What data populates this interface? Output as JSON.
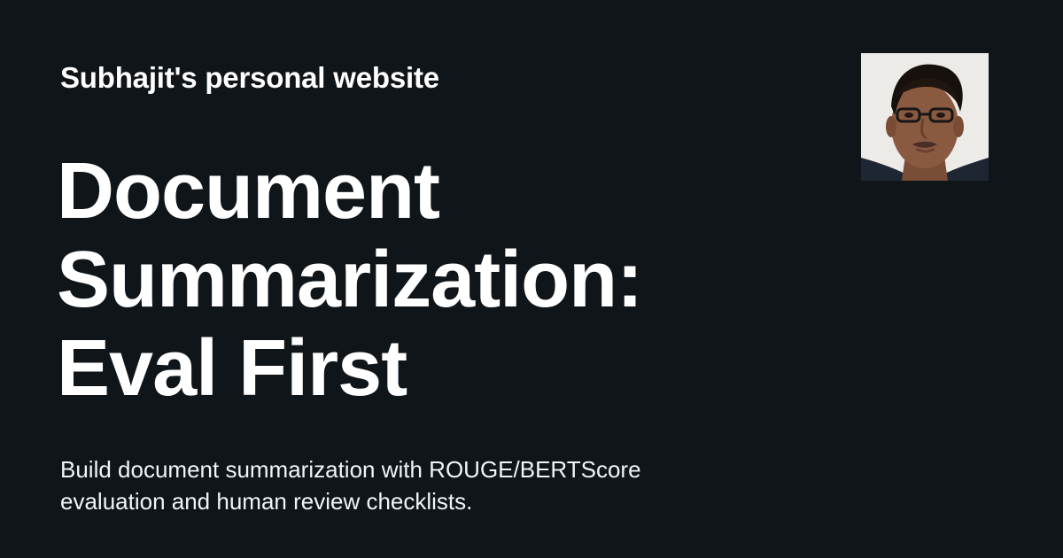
{
  "site": {
    "name": "Subhajit's personal website"
  },
  "post": {
    "title_lines": [
      "Document",
      "Summarization:",
      "Eval First"
    ],
    "description_lines": [
      "Build document summarization with ROUGE/BERTScore",
      "evaluation and human review checklists."
    ]
  },
  "avatar": {
    "icon": "profile-photo"
  },
  "colors": {
    "background": "#10151a",
    "text": "#ffffff",
    "avatar_background": "#ececea"
  }
}
